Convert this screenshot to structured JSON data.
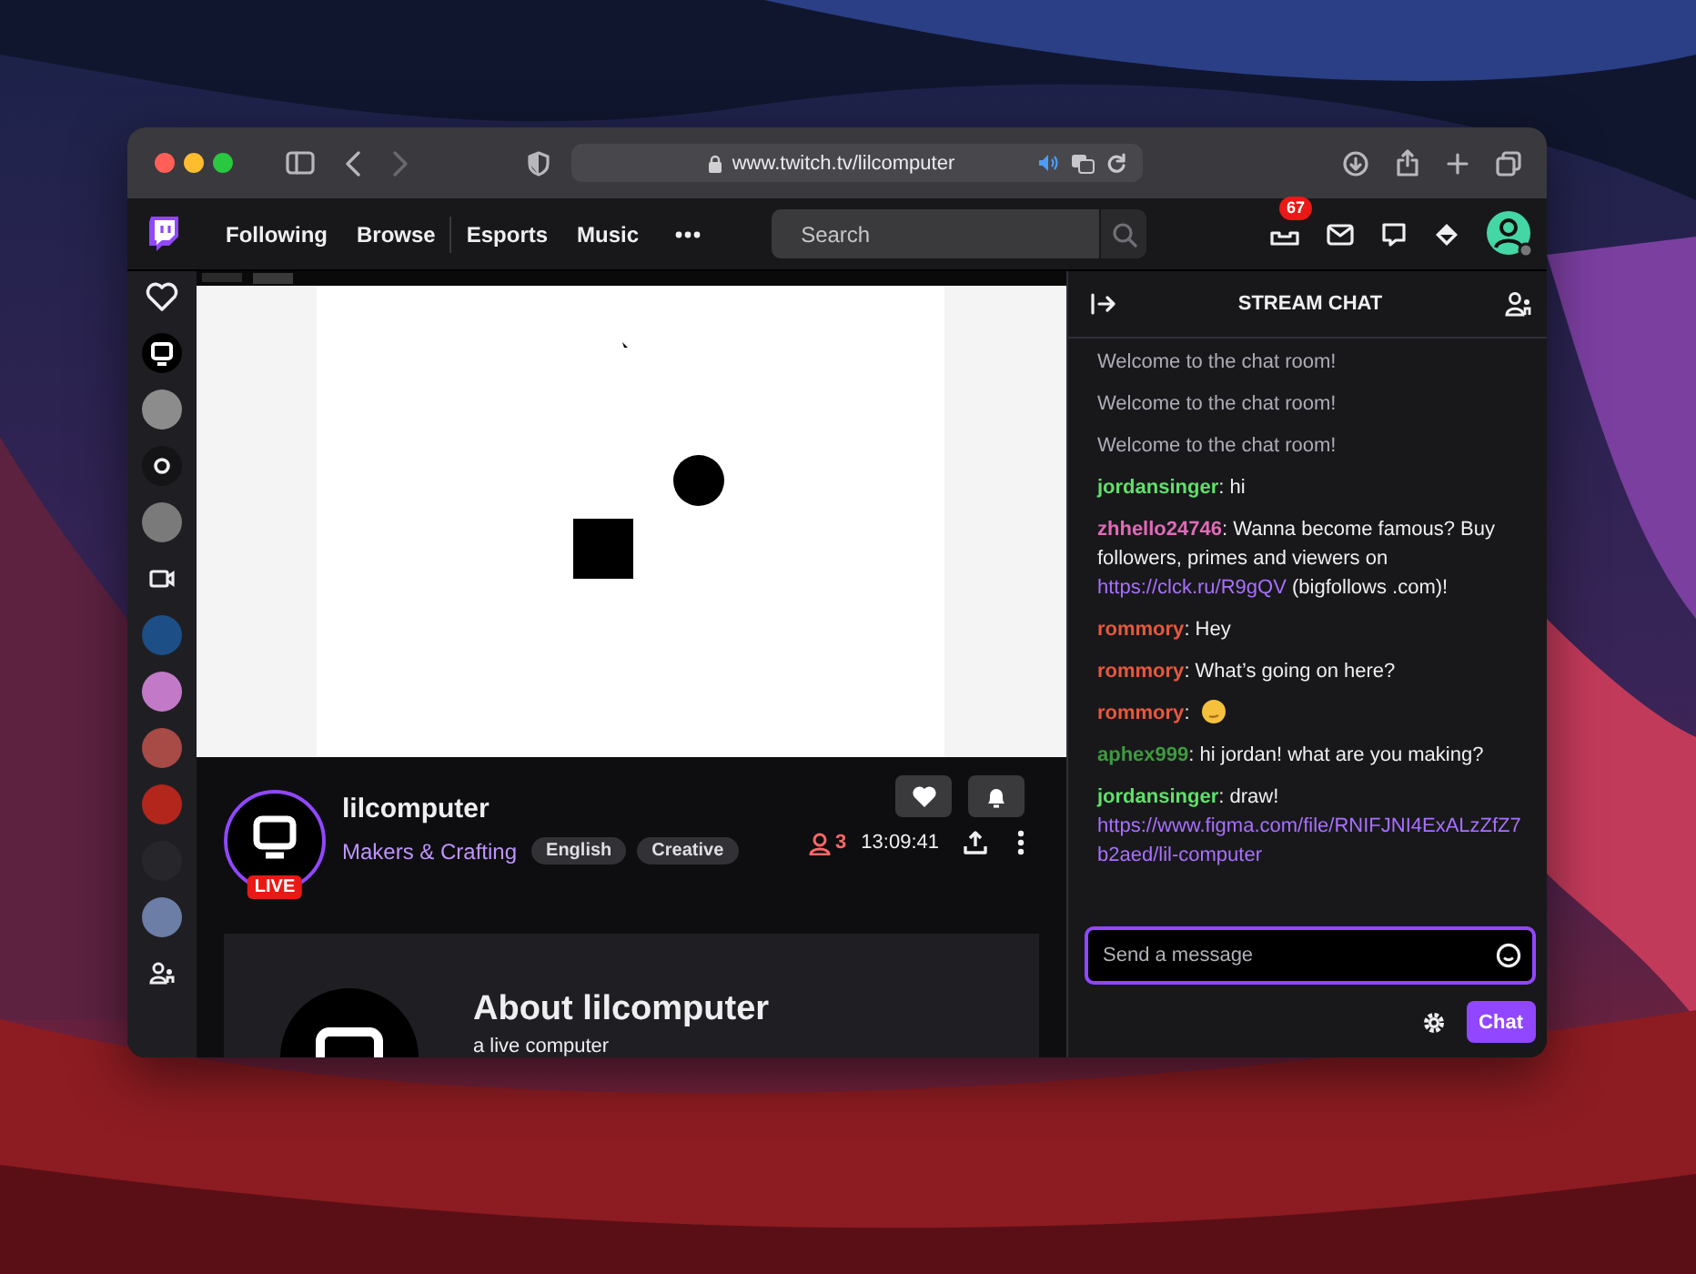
{
  "browser": {
    "url": "www.twitch.tv/lilcomputer",
    "back": {
      "disabled": false
    },
    "forward": {
      "disabled": true
    }
  },
  "nav": {
    "links": [
      "Following",
      "Browse",
      "Esports",
      "Music"
    ],
    "search": {
      "placeholder": "Search"
    },
    "inbox_badge": "67"
  },
  "sidebar": {
    "items": [
      {
        "kind": "heart"
      },
      {
        "kind": "monitor"
      },
      {
        "kind": "avatar",
        "color": "#8c8c8c"
      },
      {
        "kind": "ring"
      },
      {
        "kind": "avatar",
        "color": "#7a7a7a"
      },
      {
        "kind": "camera"
      },
      {
        "kind": "avatar",
        "color": "#1d4f86"
      },
      {
        "kind": "avatar",
        "color": "#c27ac8"
      },
      {
        "kind": "avatar",
        "color": "#a84a46"
      },
      {
        "kind": "avatar",
        "color": "#b3261b"
      },
      {
        "kind": "avatar",
        "color": "#26262b"
      },
      {
        "kind": "avatar",
        "color": "#6c7ea6"
      },
      {
        "kind": "people"
      }
    ]
  },
  "channel": {
    "name": "lilcomputer",
    "live_badge": "LIVE",
    "category": "Makers & Crafting",
    "tags": [
      "English",
      "Creative"
    ],
    "viewers": "3",
    "uptime": "13:09:41"
  },
  "about": {
    "title": "About lilcomputer",
    "description": "a live computer"
  },
  "chat": {
    "title": "STREAM CHAT",
    "messages": [
      {
        "kind": "notice",
        "text": "Welcome to the chat room!"
      },
      {
        "kind": "notice",
        "text": "Welcome to the chat room!"
      },
      {
        "kind": "notice",
        "text": "Welcome to the chat room!"
      },
      {
        "kind": "message",
        "user": "jordansinger",
        "color": "#5fe06a",
        "text": ": hi"
      },
      {
        "kind": "message",
        "user": "zhhello24746",
        "color": "#e06bb8",
        "text": ": Wanna become famous? Buy followers, primes and viewers on",
        "link": "https://clck.ru/R9gQV",
        "after": "(bigfollows .com)!"
      },
      {
        "kind": "message",
        "user": "rommory",
        "color": "#e8583c",
        "text": ": Hey"
      },
      {
        "kind": "message",
        "user": "rommory",
        "color": "#e8583c",
        "text": ": What’s going on here?"
      },
      {
        "kind": "emoji",
        "user": "rommory",
        "color": "#e8583c",
        "text": ":"
      },
      {
        "kind": "message",
        "user": "aphex999",
        "color": "#3f9a3f",
        "text": ": hi jordan! what are you making?"
      },
      {
        "kind": "message",
        "user": "jordansinger",
        "color": "#5fe06a",
        "text": ": draw!",
        "block_link": "https://www.figma.com/file/RNIFJNI4ExALzZfZ7b2aed/lil-computer"
      }
    ],
    "input": {
      "placeholder": "Send a message"
    },
    "send_button": "Chat"
  }
}
